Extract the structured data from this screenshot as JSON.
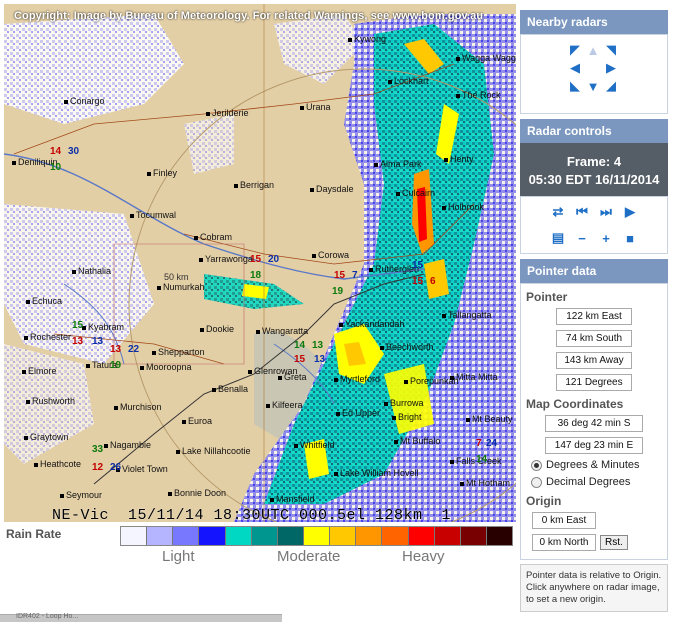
{
  "map": {
    "copyright": "Copyright: Image by Bureau of Meteorology. For related Warnings, see www.bom.gov.au",
    "stamp": "NE-Vic  15/11/14 18:30UTC 000.5el 128km  1",
    "range_label": "50 km",
    "towns": [
      {
        "name": "Kywong"
      },
      {
        "name": "Wagga Wagga"
      },
      {
        "name": "Lockhart"
      },
      {
        "name": "The Rock"
      },
      {
        "name": "Conargo"
      },
      {
        "name": "Jerilderie"
      },
      {
        "name": "Urana"
      },
      {
        "name": "Henty"
      },
      {
        "name": "Deniliquin"
      },
      {
        "name": "Finley"
      },
      {
        "name": "Berrigan"
      },
      {
        "name": "Daysdale"
      },
      {
        "name": "Alma Park"
      },
      {
        "name": "Culcairn"
      },
      {
        "name": "Holbrook"
      },
      {
        "name": "Tocumwal"
      },
      {
        "name": "Cobram"
      },
      {
        "name": "Yarrawonga"
      },
      {
        "name": "Corowa"
      },
      {
        "name": "Rutherglen"
      },
      {
        "name": "Nathalia"
      },
      {
        "name": "Numurkah"
      },
      {
        "name": "Echuca"
      },
      {
        "name": "Rochester"
      },
      {
        "name": "Kyabram"
      },
      {
        "name": "Shepparton"
      },
      {
        "name": "Tatura"
      },
      {
        "name": "Mooroopna"
      },
      {
        "name": "Dookie"
      },
      {
        "name": "Wangaratta"
      },
      {
        "name": "Yackandandah"
      },
      {
        "name": "Tallangatta"
      },
      {
        "name": "Beechworth"
      },
      {
        "name": "Elmore"
      },
      {
        "name": "Euroa"
      },
      {
        "name": "Benalla"
      },
      {
        "name": "Glenrowan"
      },
      {
        "name": "Greta"
      },
      {
        "name": "Myrtleford"
      },
      {
        "name": "Rushworth"
      },
      {
        "name": "Murchison"
      },
      {
        "name": "Kilfeera"
      },
      {
        "name": "Porepunkah"
      },
      {
        "name": "Bright"
      },
      {
        "name": "Mitta Mitta"
      },
      {
        "name": "Graytown"
      },
      {
        "name": "Mt Beauty"
      },
      {
        "name": "Nagambie"
      },
      {
        "name": "Lake Nillahcootie"
      },
      {
        "name": "Whitfield"
      },
      {
        "name": "Mt Buffalo"
      },
      {
        "name": "Heathcote"
      },
      {
        "name": "Violet Town"
      },
      {
        "name": "Falls Creek"
      },
      {
        "name": "Lake William Hovell"
      },
      {
        "name": "Bonnie Doon"
      },
      {
        "name": "Seymour"
      },
      {
        "name": "Mansfield"
      },
      {
        "name": "Mt Hotham"
      },
      {
        "name": "Ed Upper"
      },
      {
        "name": "Burrowa"
      }
    ],
    "warnings": [
      {
        "text": "14",
        "color": "red"
      },
      {
        "text": "30",
        "color": "blue"
      },
      {
        "text": "10",
        "color": "green"
      },
      {
        "text": "15",
        "color": "red"
      },
      {
        "text": "20",
        "color": "blue"
      },
      {
        "text": "18",
        "color": "green"
      },
      {
        "text": "15",
        "color": "red"
      },
      {
        "text": "7",
        "color": "blue"
      },
      {
        "text": "19",
        "color": "green"
      },
      {
        "text": "15",
        "color": "blue"
      },
      {
        "text": "15",
        "color": "red"
      },
      {
        "text": "6",
        "color": "red"
      },
      {
        "text": "15",
        "color": "green"
      },
      {
        "text": "13",
        "color": "red"
      },
      {
        "text": "13",
        "color": "blue"
      },
      {
        "text": "13",
        "color": "red"
      },
      {
        "text": "22",
        "color": "blue"
      },
      {
        "text": "19",
        "color": "green"
      },
      {
        "text": "14",
        "color": "green"
      },
      {
        "text": "15",
        "color": "red"
      },
      {
        "text": "13",
        "color": "blue"
      },
      {
        "text": "13",
        "color": "green"
      },
      {
        "text": "7",
        "color": "red"
      },
      {
        "text": "24",
        "color": "blue"
      },
      {
        "text": "14",
        "color": "green"
      },
      {
        "text": "12",
        "color": "red"
      },
      {
        "text": "26",
        "color": "blue"
      },
      {
        "text": "33",
        "color": "green"
      }
    ]
  },
  "legend": {
    "label": "Rain Rate",
    "light": "Light",
    "moderate": "Moderate",
    "heavy": "Heavy",
    "colors": [
      "#f5f5ff",
      "#b4b4ff",
      "#7878ff",
      "#1414ff",
      "#00d8c3",
      "#009690",
      "#006666",
      "#ffff00",
      "#ffc800",
      "#ff9600",
      "#ff6400",
      "#ff0000",
      "#c80000",
      "#780000",
      "#280000"
    ]
  },
  "panel": {
    "nearby_title": "Nearby radars",
    "controls_title": "Radar controls",
    "frame": "Frame: 4",
    "datetime": "05:30 EDT 16/11/2014",
    "pointer_title": "Pointer data",
    "pointer_sub": "Pointer",
    "east": "122 km East",
    "south": "74 km South",
    "away": "143 km Away",
    "degrees": "121 Degrees",
    "map_coords_sub": "Map Coordinates",
    "lat": "36 deg 42 min S",
    "lon": "147 deg 23 min E",
    "opt_dm": "Degrees & Minutes",
    "opt_dd": "Decimal Degrees",
    "origin_sub": "Origin",
    "origin_east": "0 km East",
    "origin_north": "0 km North",
    "reset": "Rst.",
    "note": "Pointer data is relative to Origin. Click anywhere on radar image, to set a new origin."
  },
  "statusbar": {
    "tab": "IDR402 - Loop Ho..."
  }
}
